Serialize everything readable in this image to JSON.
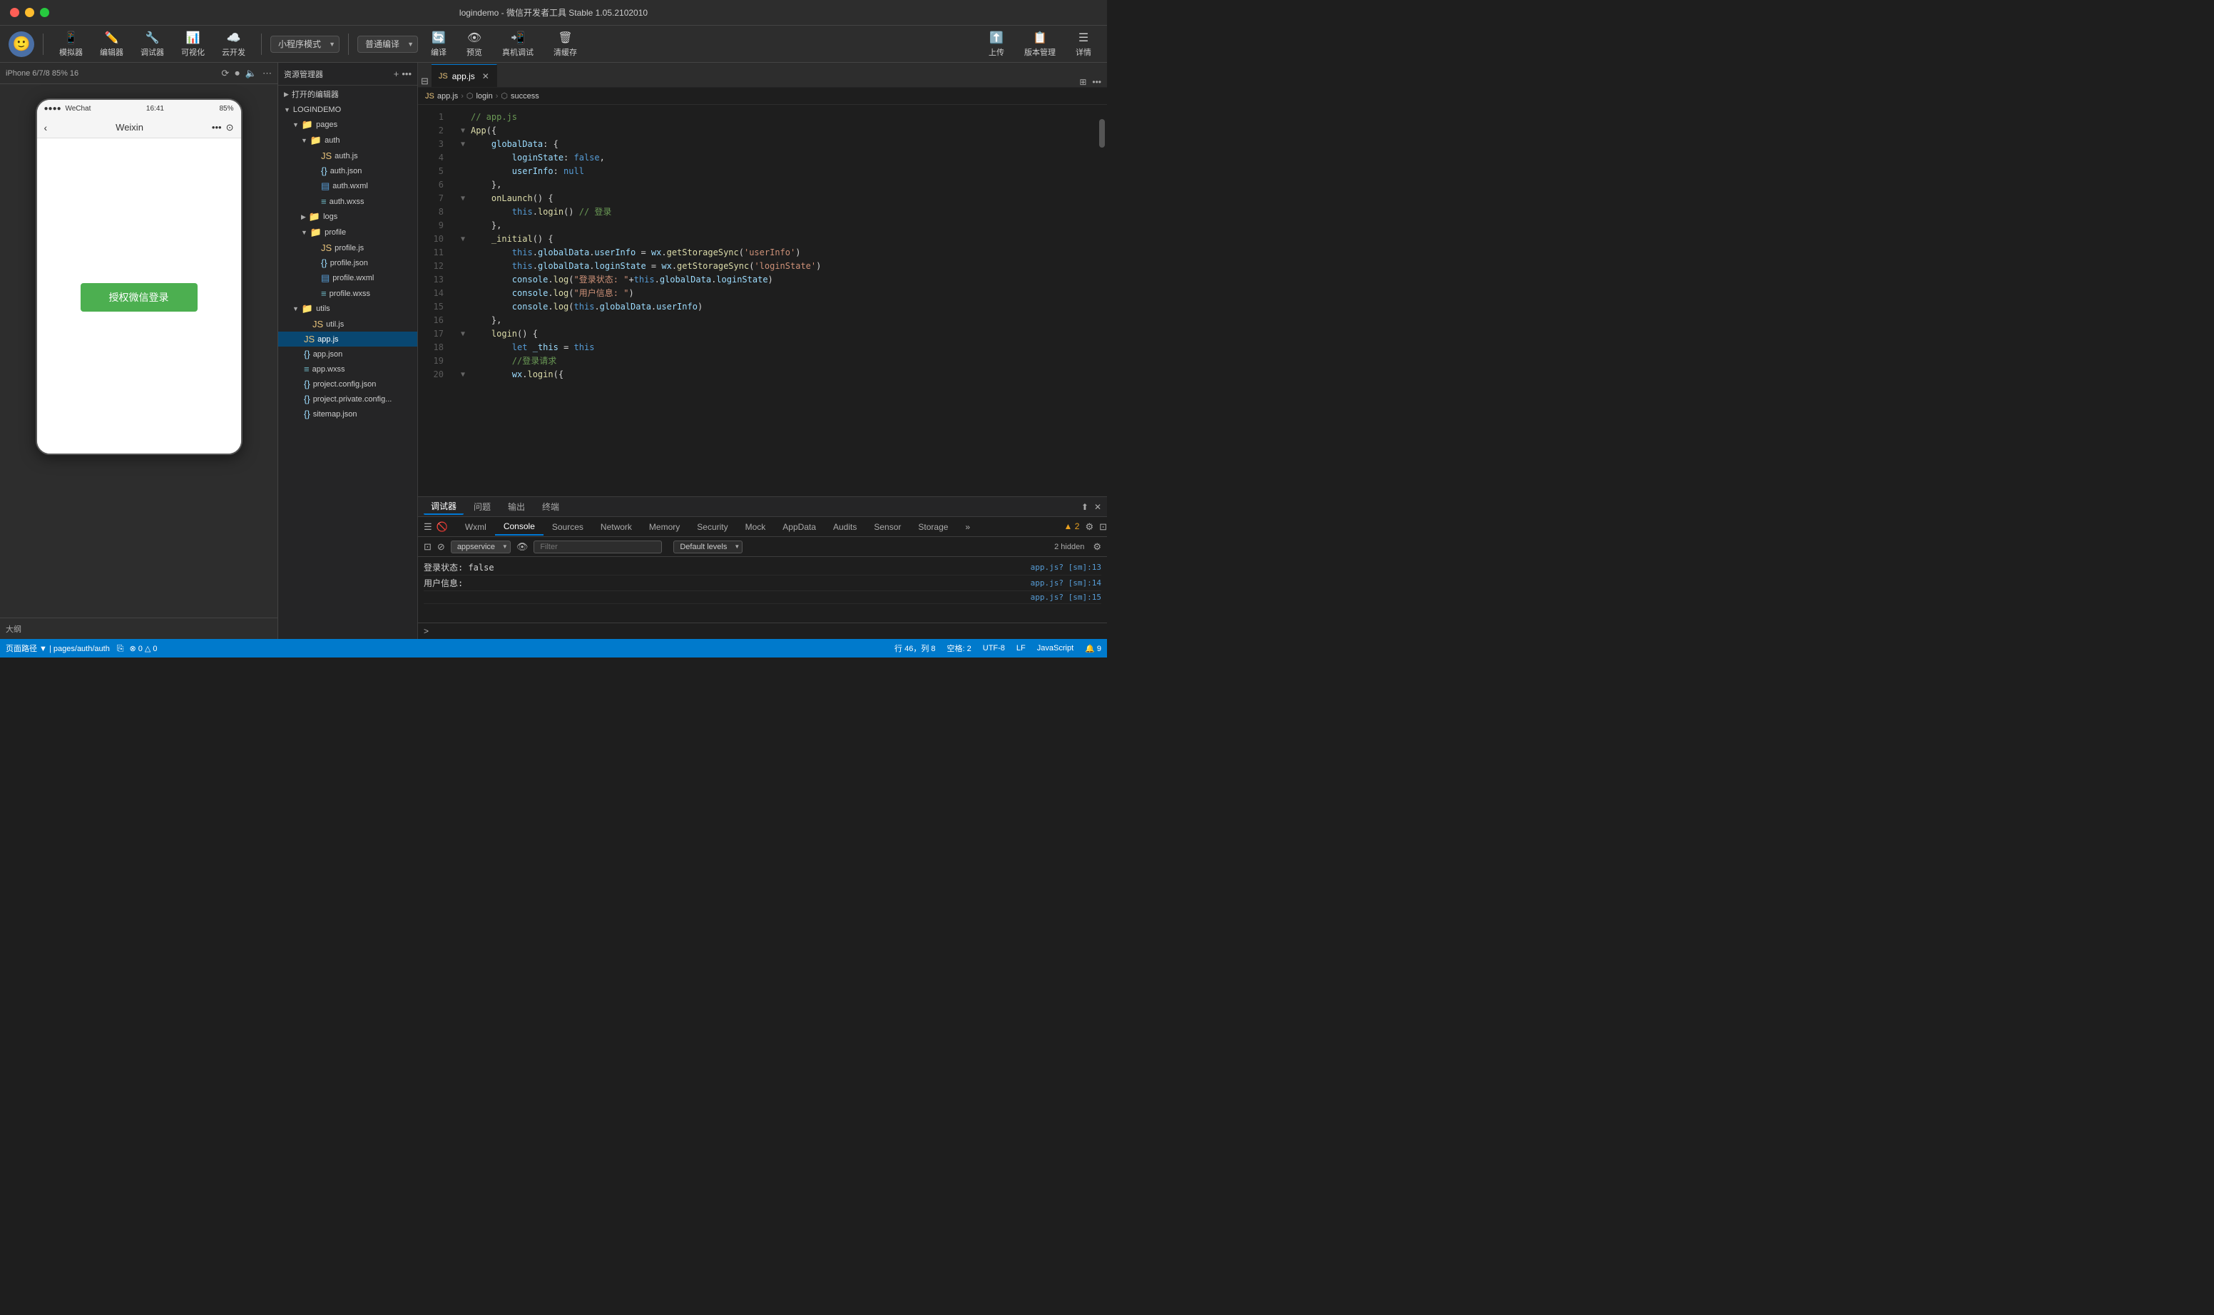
{
  "titleBar": {
    "title": "logindemo - 微信开发者工具 Stable 1.05.2102010"
  },
  "toolbar": {
    "simulator_label": "模拟器",
    "editor_label": "编辑器",
    "debugger_label": "调试器",
    "visualize_label": "可视化",
    "cloud_label": "云开发",
    "mode_options": [
      "小程序模式"
    ],
    "compile_options": [
      "普通编译"
    ],
    "compile_label": "编译",
    "preview_label": "预览",
    "real_debug_label": "真机调试",
    "clear_cache_label": "清缓存",
    "upload_label": "上传",
    "version_label": "版本管理",
    "details_label": "详情"
  },
  "simulator": {
    "device_label": "iPhone 6/7/8 85% 16",
    "status_time": "16:41",
    "status_signal": "●●●●",
    "status_wifi": "WeChat",
    "status_battery": "85%",
    "nav_title": "Weixin",
    "login_btn": "授权微信登录"
  },
  "fileTree": {
    "resources_label": "资源管理器",
    "open_editors_label": "打开的编辑器",
    "project_name": "LOGINDEMO",
    "items": [
      {
        "id": "pages",
        "name": "pages",
        "type": "folder",
        "indent": 1,
        "expanded": true
      },
      {
        "id": "auth",
        "name": "auth",
        "type": "folder",
        "indent": 2,
        "expanded": true
      },
      {
        "id": "auth.js",
        "name": "auth.js",
        "type": "js",
        "indent": 3
      },
      {
        "id": "auth.json",
        "name": "auth.json",
        "type": "json",
        "indent": 3
      },
      {
        "id": "auth.wxml",
        "name": "auth.wxml",
        "type": "wxml",
        "indent": 3
      },
      {
        "id": "auth.wxss",
        "name": "auth.wxss",
        "type": "wxss",
        "indent": 3
      },
      {
        "id": "logs",
        "name": "logs",
        "type": "folder",
        "indent": 2,
        "expanded": false
      },
      {
        "id": "profile",
        "name": "profile",
        "type": "folder",
        "indent": 2,
        "expanded": true
      },
      {
        "id": "profile.js",
        "name": "profile.js",
        "type": "js",
        "indent": 3
      },
      {
        "id": "profile.json",
        "name": "profile.json",
        "type": "json",
        "indent": 3
      },
      {
        "id": "profile.wxml",
        "name": "profile.wxml",
        "type": "wxml",
        "indent": 3
      },
      {
        "id": "profile.wxss",
        "name": "profile.wxss",
        "type": "wxss",
        "indent": 3
      },
      {
        "id": "utils",
        "name": "utils",
        "type": "folder",
        "indent": 1,
        "expanded": true
      },
      {
        "id": "util.js",
        "name": "util.js",
        "type": "js",
        "indent": 2
      },
      {
        "id": "app.js",
        "name": "app.js",
        "type": "js",
        "indent": 1,
        "active": true
      },
      {
        "id": "app.json",
        "name": "app.json",
        "type": "json",
        "indent": 1
      },
      {
        "id": "app.wxss",
        "name": "app.wxss",
        "type": "wxss",
        "indent": 1
      },
      {
        "id": "project.config.json",
        "name": "project.config.json",
        "type": "json",
        "indent": 1
      },
      {
        "id": "project.private.config",
        "name": "project.private.config...",
        "type": "json",
        "indent": 1
      },
      {
        "id": "sitemap.json",
        "name": "sitemap.json",
        "type": "json",
        "indent": 1
      }
    ],
    "outline_label": "大纲"
  },
  "editor": {
    "tab": "app.js",
    "breadcrumbs": [
      "app.js",
      "login",
      "success"
    ],
    "lines": [
      {
        "n": 1,
        "code": "// app.js",
        "type": "comment"
      },
      {
        "n": 2,
        "code": "App({",
        "fold": true
      },
      {
        "n": 3,
        "code": "    globalData: {",
        "fold": true,
        "indent": 1
      },
      {
        "n": 4,
        "code": "        loginState: false,",
        "indent": 2
      },
      {
        "n": 5,
        "code": "        userInfo: null",
        "indent": 2
      },
      {
        "n": 6,
        "code": "    },",
        "indent": 1
      },
      {
        "n": 7,
        "code": "    onLaunch() {",
        "fold": true,
        "indent": 1
      },
      {
        "n": 8,
        "code": "        this.login() // 登录",
        "indent": 2
      },
      {
        "n": 9,
        "code": "    },",
        "indent": 1
      },
      {
        "n": 10,
        "code": "    _initial() {",
        "fold": true,
        "indent": 1
      },
      {
        "n": 11,
        "code": "        this.globalData.userInfo = wx.getStorageSync('userInfo')",
        "indent": 2
      },
      {
        "n": 12,
        "code": "        this.globalData.loginState = wx.getStorageSync('loginState')",
        "indent": 2
      },
      {
        "n": 13,
        "code": "        console.log(\"登录状态: \"+this.globalData.loginState)",
        "indent": 2
      },
      {
        "n": 14,
        "code": "        console.log(\"用户信息: \")",
        "indent": 2
      },
      {
        "n": 15,
        "code": "        console.log(this.globalData.userInfo)",
        "indent": 2
      },
      {
        "n": 16,
        "code": "    },",
        "indent": 1
      },
      {
        "n": 17,
        "code": "    login() {",
        "fold": true,
        "indent": 1
      },
      {
        "n": 18,
        "code": "        let _this = this",
        "indent": 2
      },
      {
        "n": 19,
        "code": "        //登录请求",
        "indent": 2,
        "type": "comment"
      },
      {
        "n": 20,
        "code": "        wx.login({",
        "indent": 2,
        "partial": true
      }
    ]
  },
  "devtools": {
    "tabs": [
      "调试器",
      "问题",
      "输出",
      "终端"
    ],
    "console_tabs": [
      "Wxml",
      "Console",
      "Sources",
      "Network",
      "Memory",
      "Security",
      "Mock",
      "AppData",
      "Audits",
      "Sensor",
      "Storage"
    ],
    "active_tab": "Console",
    "service_name": "appservice",
    "filter_placeholder": "Filter",
    "level_label": "Default levels",
    "hidden_count": "2 hidden",
    "console_lines": [
      {
        "text": "登录状态: false",
        "ref": "app.js? [sm]:13"
      },
      {
        "text": "用户信息:",
        "ref": "app.js? [sm]:14"
      },
      {
        "text": "",
        "ref": "app.js? [sm]:15"
      }
    ],
    "warning_count": "2"
  },
  "statusBar": {
    "path": "页面路径 ▼ | pages/auth/auth",
    "errors": "⊗ 0 △ 0",
    "line_col": "行 46，列 8",
    "spaces": "空格: 2",
    "encoding": "UTF-8",
    "eol": "LF",
    "lang": "JavaScript",
    "bell": "🔔 9"
  }
}
